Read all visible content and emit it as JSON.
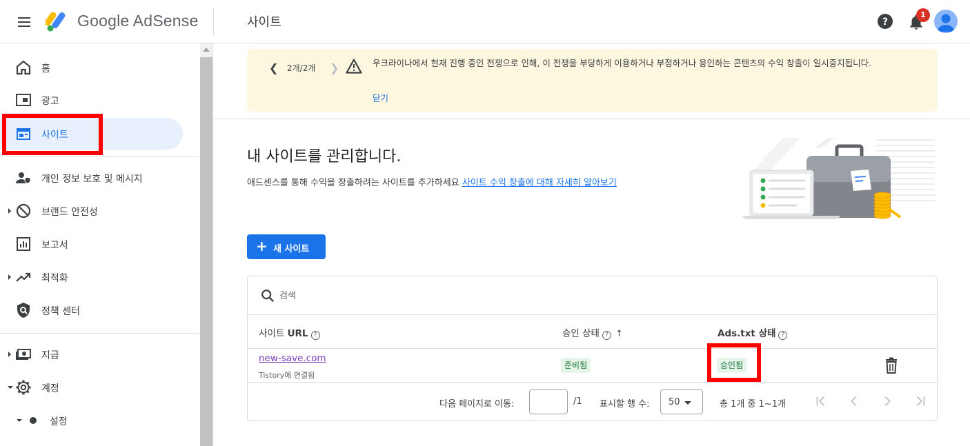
{
  "app": {
    "brand": "Google AdSense",
    "page_title": "사이트"
  },
  "header": {
    "notification_count": "1"
  },
  "sidebar": {
    "items": [
      {
        "label": "홈",
        "icon": "home-icon"
      },
      {
        "label": "광고",
        "icon": "ads-icon"
      },
      {
        "label": "사이트",
        "icon": "sites-icon",
        "active": true
      },
      {
        "label": "개인 정보 보호 및 메시지",
        "icon": "privacy-icon"
      },
      {
        "label": "브랜드 안전성",
        "icon": "block-icon"
      },
      {
        "label": "보고서",
        "icon": "report-icon"
      },
      {
        "label": "최적화",
        "icon": "trending-icon"
      },
      {
        "label": "정책 센터",
        "icon": "policy-icon"
      },
      {
        "label": "지급",
        "icon": "payments-icon"
      },
      {
        "label": "계정",
        "icon": "gear-icon"
      },
      {
        "label": "설정",
        "icon": "dot-icon"
      }
    ]
  },
  "banner": {
    "pager": "2개/2개",
    "message": "우크라이나에서 현재 진행 중인 전쟁으로 인해, 이 전쟁을 부당하게 이용하거나 부정하거나 용인하는 콘텐츠의 수익 창출이 일시중지됩니다.",
    "close": "닫기"
  },
  "main": {
    "heading": "내 사이트를 관리합니다.",
    "description": "애드센스를 통해 수익을 창출하려는 사이트를 추가하세요",
    "learn_more": "사이트 수익 창출에 대해 자세히 알아보기",
    "new_site_button": "새 사이트"
  },
  "table": {
    "search_placeholder": "검색",
    "columns": {
      "url_prefix": "사이트",
      "url_bold": "URL",
      "approval": "승인 상태",
      "adstxt": "Ads.txt 상태"
    },
    "rows": [
      {
        "url": "new-save.com",
        "sub": "Tistory에 연결됨",
        "approval": "준비됨",
        "adstxt": "승인됨"
      }
    ],
    "pagination": {
      "goto_label": "다음 페이지로 이동:",
      "page_total": "/1",
      "rows_label": "표시할 행 수:",
      "rows_value": "50",
      "range": "총 1개 중 1~1개"
    }
  }
}
